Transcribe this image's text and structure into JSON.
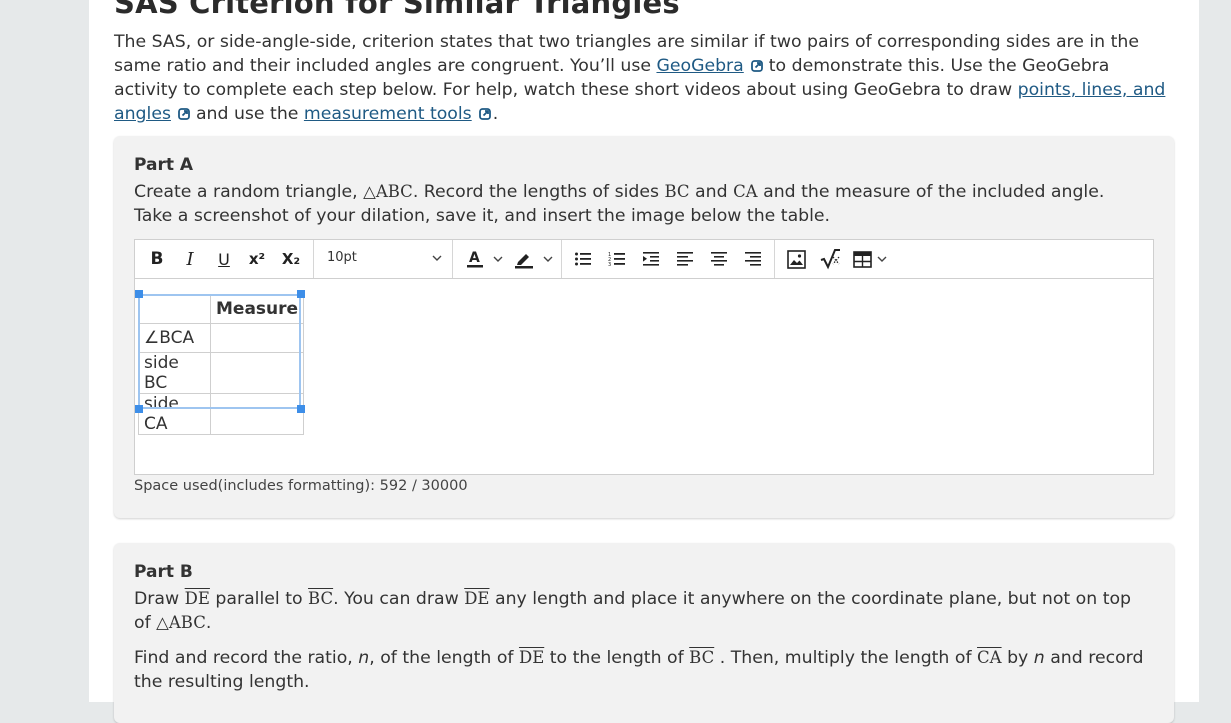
{
  "title": "SAS Criterion for Similar Triangles",
  "intro": {
    "t1": "The SAS, or side-angle-side, criterion states that two triangles are similar if two pairs of corresponding sides are in the same ratio and their included angles are congruent. You’ll use ",
    "link1": "GeoGebra",
    "t2": "to demonstrate this. Use the GeoGebra activity to complete each step below. For help, watch these short videos about using GeoGebra to draw ",
    "link2": "points, lines, and angles",
    "t3": "and use the ",
    "link3": "measurement tools",
    "t4": "."
  },
  "partA": {
    "title": "Part A",
    "p1": "Create a random triangle, ",
    "tri": "△ABC",
    "p2": ". Record the lengths of sides ",
    "bc": "BC",
    "p3": " and ",
    "ca": "CA",
    "p4": " and the measure of the included angle. Take a screenshot of your dilation, save it, and insert the image below the table.",
    "toolbar": {
      "bold": "B",
      "italic": "I",
      "underline": "U",
      "superscript": "x²",
      "subscript": "X₂",
      "font_size": "10pt"
    },
    "table": {
      "header": [
        "",
        "Measure"
      ],
      "rows": [
        [
          "∠BCA",
          ""
        ],
        [
          "side BC",
          ""
        ],
        [
          "side CA",
          ""
        ]
      ]
    },
    "space_used": "Space used(includes formatting): 592 / 30000"
  },
  "partB": {
    "title": "Part B",
    "q1": {
      "a": "Draw ",
      "de": "DE",
      "b": " parallel to ",
      "bc": "BC",
      "c": ". You can draw ",
      "de2": "DE",
      "d": " any length and place it anywhere on the coordinate plane, but not on top of ",
      "tri": "△ABC",
      "e": "."
    },
    "q2": {
      "a": "Find and record the ratio, ",
      "n": "n",
      "b": ", of the length of ",
      "de": "DE",
      "c": " to the length of ",
      "bc": "BC",
      "d": " . Then, multiply the length of ",
      "ca": "CA",
      "e": " by ",
      "n2": "n",
      "f": " and record the resulting length."
    }
  },
  "colors": {
    "link": "#1f5a84",
    "accent": "#3d8ee8",
    "card_bg": "#f2f2f2",
    "page_bg": "#e6e9ea"
  }
}
